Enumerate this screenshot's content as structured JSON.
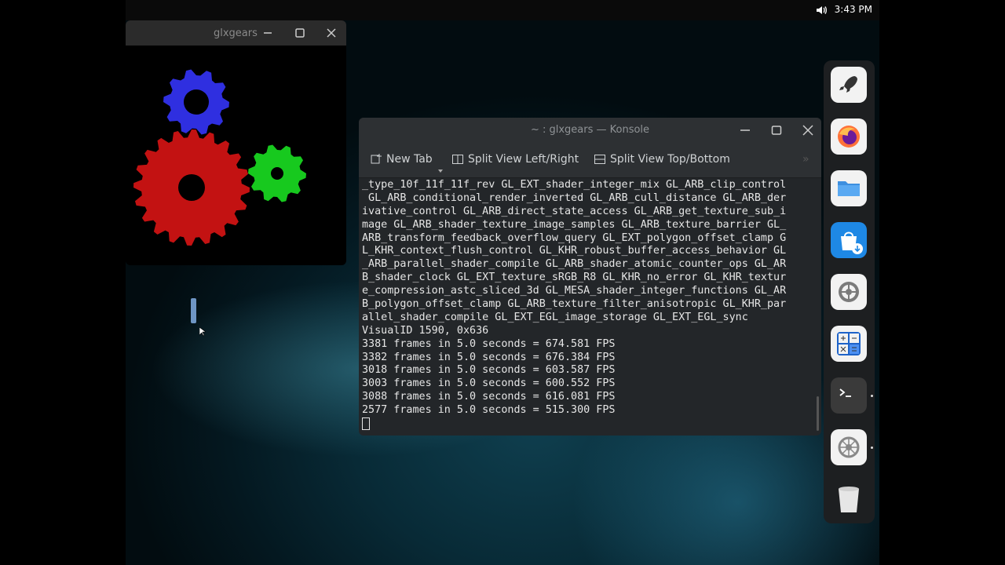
{
  "topbar": {
    "time": "3:43 PM",
    "volume_icon": "speaker-icon"
  },
  "glxgears_window": {
    "title": "glxgears",
    "gear_colors": {
      "blue": "#2f2fe0",
      "red": "#c31212",
      "green": "#17c91e"
    }
  },
  "konsole": {
    "title": "~ : glxgears — Konsole",
    "toolbar": {
      "new_tab": "New Tab",
      "split_left_right": "Split View Left/Right",
      "split_top_bottom": "Split View Top/Bottom",
      "overflow": "»"
    },
    "lines": [
      "_type_10f_11f_11f_rev GL_EXT_shader_integer_mix GL_ARB_clip_control",
      " GL_ARB_conditional_render_inverted GL_ARB_cull_distance GL_ARB_der",
      "ivative_control GL_ARB_direct_state_access GL_ARB_get_texture_sub_i",
      "mage GL_ARB_shader_texture_image_samples GL_ARB_texture_barrier GL_",
      "ARB_transform_feedback_overflow_query GL_EXT_polygon_offset_clamp G",
      "L_KHR_context_flush_control GL_KHR_robust_buffer_access_behavior GL",
      "_ARB_parallel_shader_compile GL_ARB_shader_atomic_counter_ops GL_AR",
      "B_shader_clock GL_EXT_texture_sRGB_R8 GL_KHR_no_error GL_KHR_textur",
      "e_compression_astc_sliced_3d GL_MESA_shader_integer_functions GL_AR",
      "B_polygon_offset_clamp GL_ARB_texture_filter_anisotropic GL_KHR_par",
      "allel_shader_compile GL_EXT_EGL_image_storage GL_EXT_EGL_sync",
      "VisualID 1590, 0x636",
      "3381 frames in 5.0 seconds = 674.581 FPS",
      "3382 frames in 5.0 seconds = 676.384 FPS",
      "3018 frames in 5.0 seconds = 603.587 FPS",
      "3003 frames in 5.0 seconds = 600.552 FPS",
      "3088 frames in 5.0 seconds = 616.081 FPS",
      "2577 frames in 5.0 seconds = 515.300 FPS"
    ]
  },
  "dock": {
    "items": [
      {
        "icon": "rocket-launcher-icon"
      },
      {
        "icon": "firefox-icon"
      },
      {
        "icon": "folder-icon"
      },
      {
        "icon": "software-store-icon"
      },
      {
        "icon": "settings-icon"
      },
      {
        "icon": "calculator-icon"
      },
      {
        "icon": "terminal-icon",
        "running": true
      },
      {
        "icon": "system-settings-icon",
        "running": true
      },
      {
        "icon": "trash-icon"
      }
    ]
  }
}
